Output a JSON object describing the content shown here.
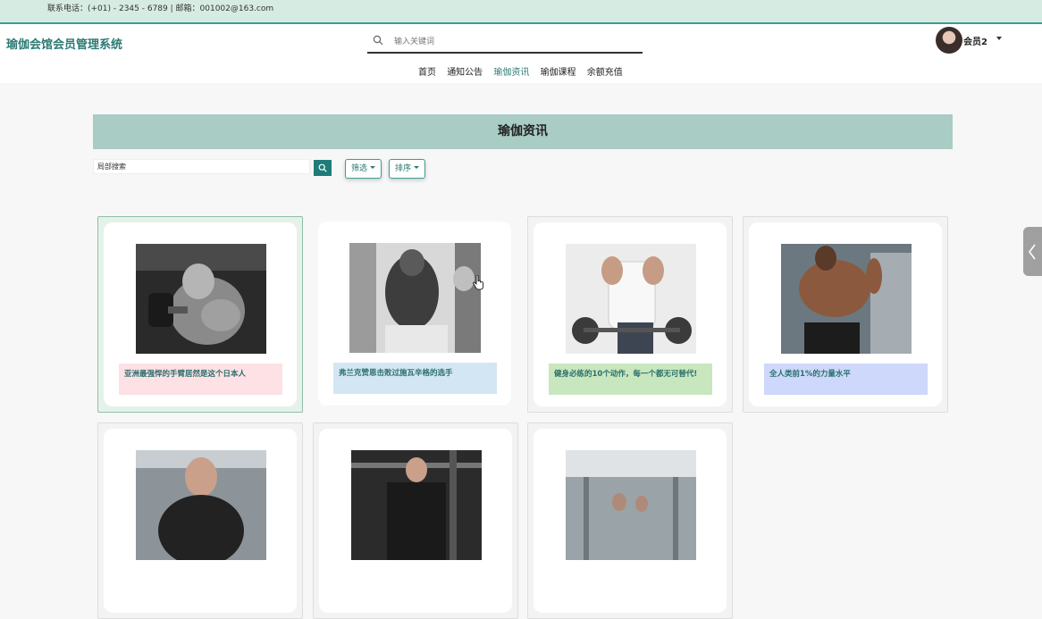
{
  "topbar": {
    "contact": "联系电话：(+01) - 2345 - 6789 | 邮箱：001002@163.com"
  },
  "header": {
    "title": "瑜伽会馆会员管理系统",
    "search_placeholder": "输入关键词",
    "username": "会员2"
  },
  "nav": {
    "items": [
      "首页",
      "通知公告",
      "瑜伽资讯",
      "瑜伽课程",
      "余额充值"
    ],
    "active": "瑜伽资讯"
  },
  "page": {
    "heading": "瑜伽资讯",
    "local_search_value": "局部搜索",
    "filter_label": "筛选",
    "sort_label": "排序"
  },
  "articles": [
    {
      "title": "亚洲最强悍的手臂居然是这个日本人",
      "caption_color": "#fde1e4"
    },
    {
      "title": "弗兰克赞恩击败过施瓦辛格的选手",
      "caption_color": "#d3e6f3"
    },
    {
      "title": "健身必练的10个动作，每一个都无可替代!",
      "caption_color": "#c9e7be"
    },
    {
      "title": "全人类前1%的力量水平",
      "caption_color": "#cdd8fb"
    },
    {
      "title": "",
      "caption_color": ""
    },
    {
      "title": "",
      "caption_color": ""
    },
    {
      "title": "",
      "caption_color": ""
    }
  ],
  "colors": {
    "accent": "#2c7a74",
    "banner": "#a9ccc4",
    "topbar": "#d6ece2"
  }
}
